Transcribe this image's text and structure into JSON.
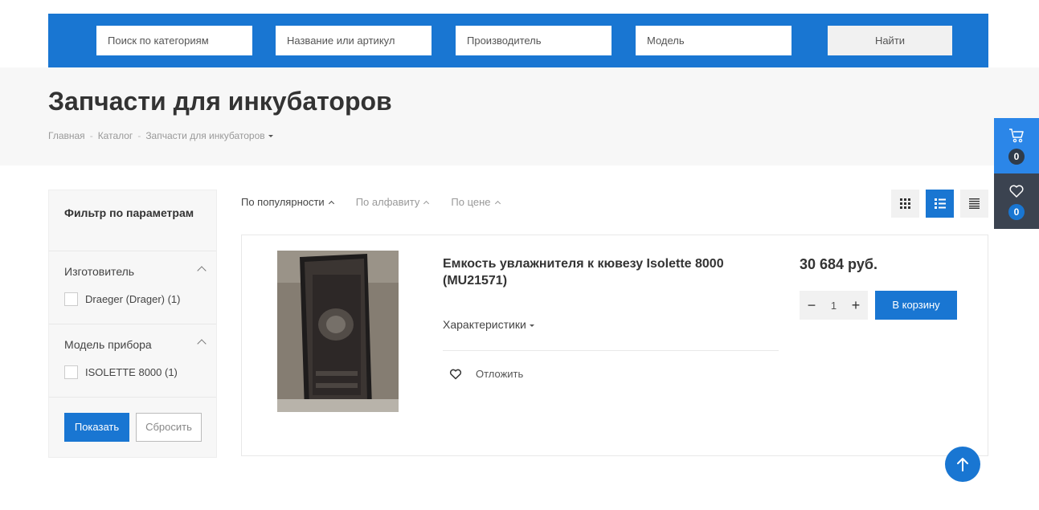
{
  "search": {
    "category_placeholder": "Поиск по категориям",
    "name_placeholder": "Название или артикул",
    "manufacturer_placeholder": "Производитель",
    "model_placeholder": "Модель",
    "submit_label": "Найти"
  },
  "page": {
    "title": "Запчасти для инкубаторов",
    "breadcrumbs": [
      "Главная",
      "Каталог",
      "Запчасти для инкубаторов"
    ],
    "breadcrumb_sep": "-"
  },
  "side_widgets": {
    "cart_count": "0",
    "favorites_count": "0"
  },
  "filter": {
    "title": "Фильтр по параметрам",
    "groups": [
      {
        "title": "Изготовитель",
        "options": [
          "Draeger (Drager) (1)"
        ]
      },
      {
        "title": "Модель прибора",
        "options": [
          "ISOLETTE 8000 (1)"
        ]
      }
    ],
    "show_label": "Показать",
    "reset_label": "Сбросить"
  },
  "sorting": {
    "items": [
      "По популярности",
      "По алфавиту",
      "По цене"
    ],
    "active": "По популярности"
  },
  "views": {
    "active": "list",
    "options": [
      "grid",
      "list",
      "table"
    ]
  },
  "product": {
    "name": "Емкость увлажнителя к кювезу Isolette 8000 (MU21571)",
    "properties_label": "Характеристики",
    "favorite_label": "Отложить",
    "price": "30 684 руб.",
    "quantity": "1",
    "cart_label": "В корзину"
  },
  "colors": {
    "brand": "#1976d2",
    "cart_widget": "#2b86e8",
    "fav_widget": "#3b4350"
  }
}
